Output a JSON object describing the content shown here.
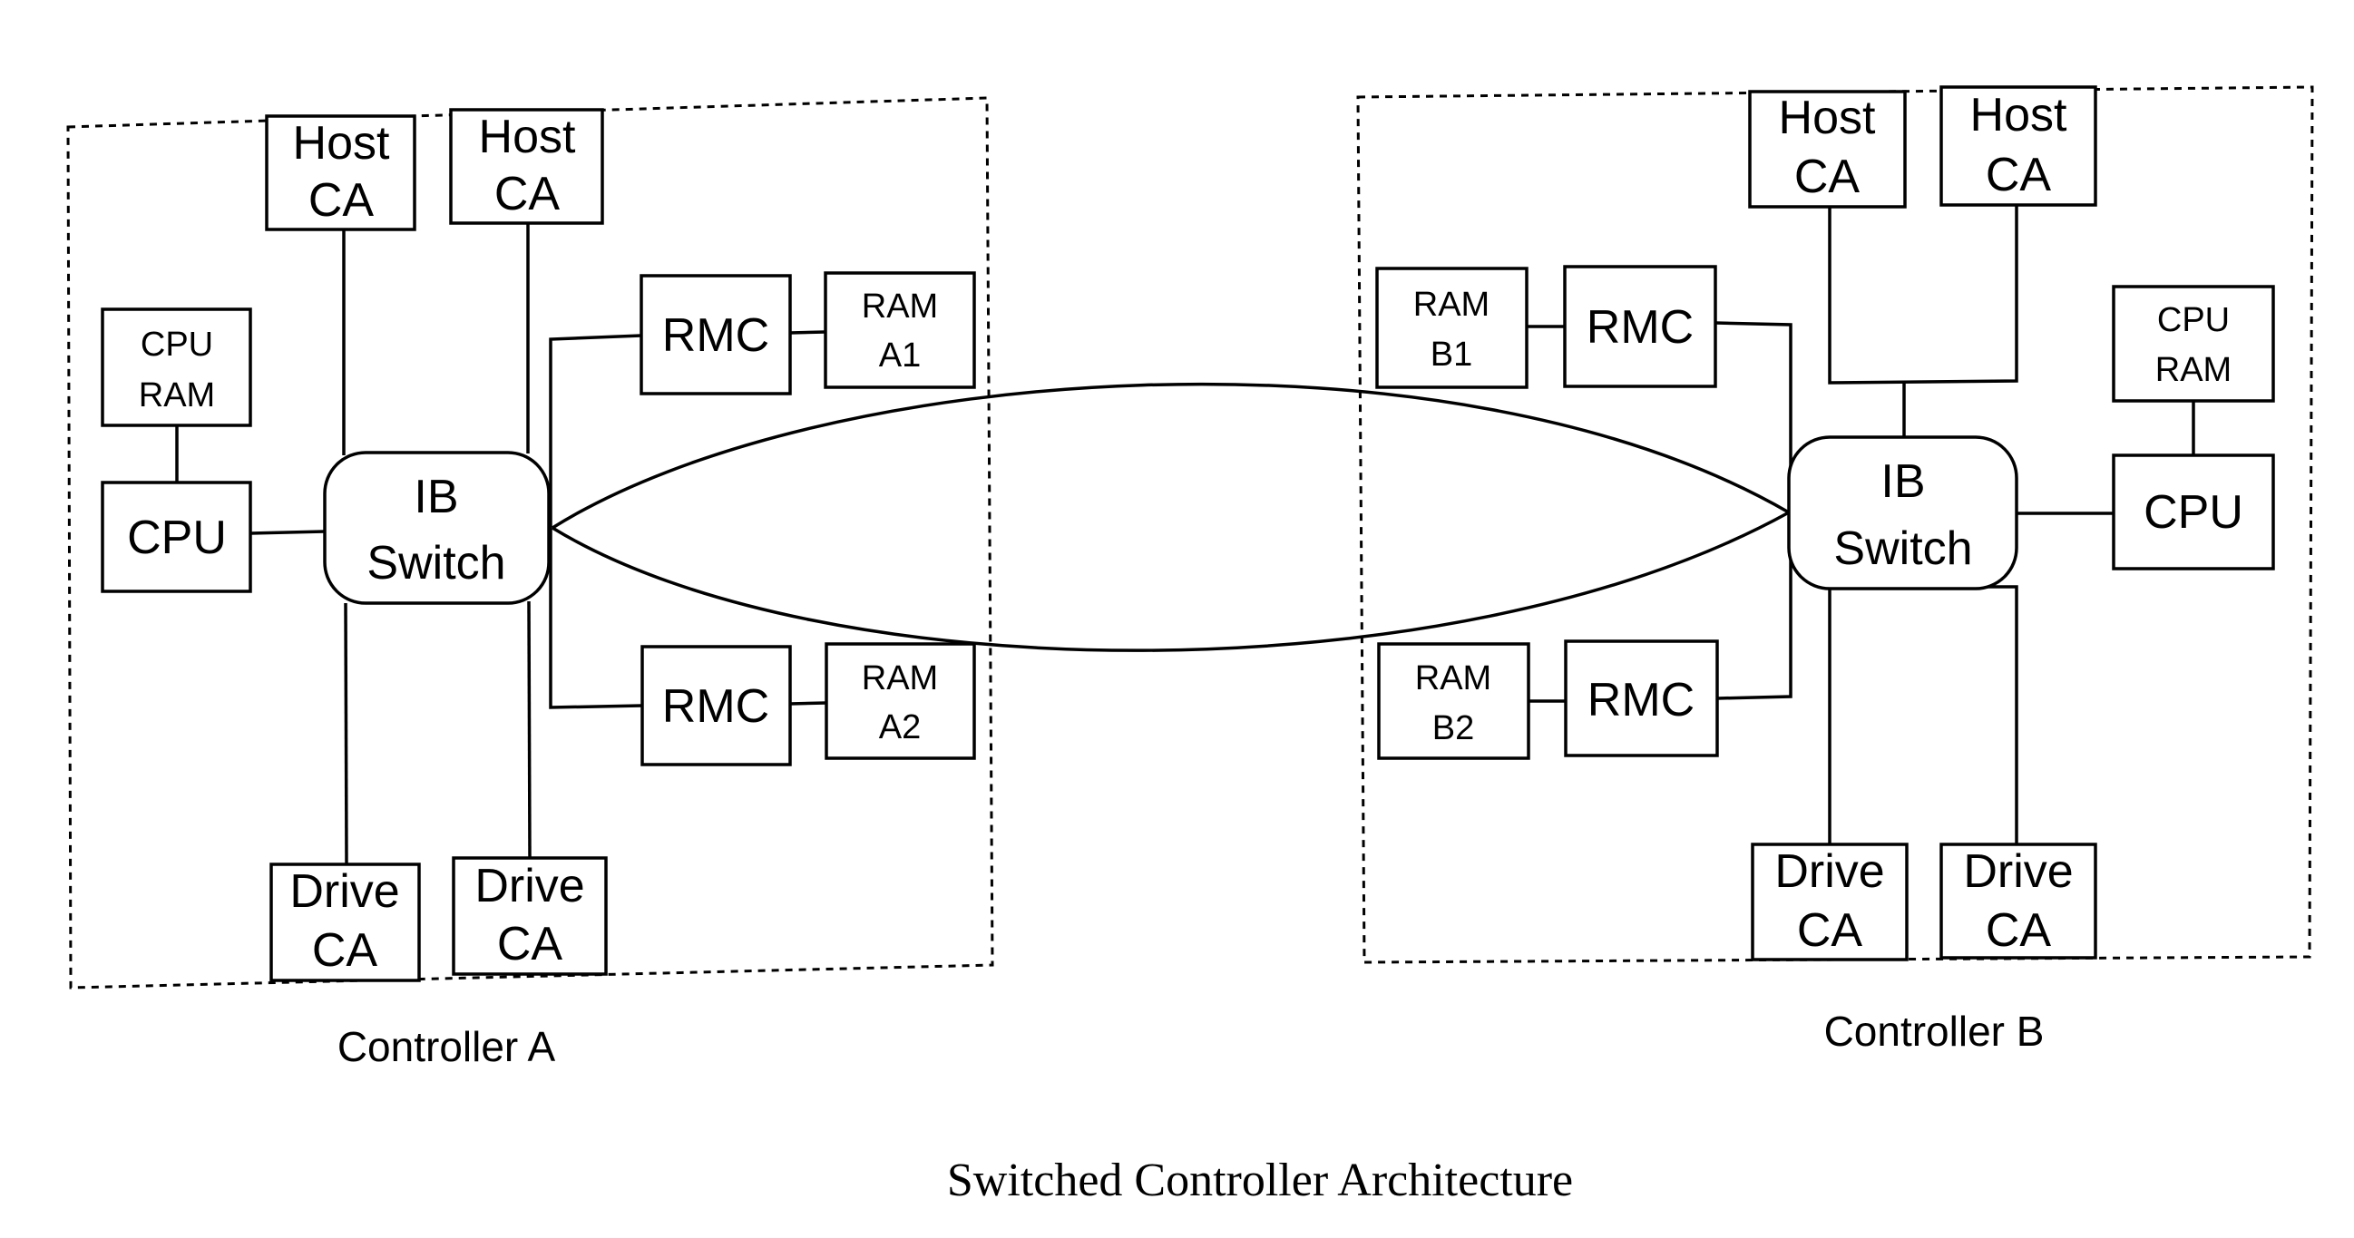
{
  "caption": "Switched Controller Architecture",
  "controller_a": {
    "label": "Controller A",
    "host_ca_1": [
      "Host",
      "CA"
    ],
    "host_ca_2": [
      "Host",
      "CA"
    ],
    "cpu_ram": [
      "CPU",
      "RAM"
    ],
    "cpu": "CPU",
    "switch": [
      "IB",
      "Switch"
    ],
    "rmc_1": "RMC",
    "ram_1": [
      "RAM",
      "A1"
    ],
    "rmc_2": "RMC",
    "ram_2": [
      "RAM",
      "A2"
    ],
    "drive_ca_1": [
      "Drive",
      "CA"
    ],
    "drive_ca_2": [
      "Drive",
      "CA"
    ]
  },
  "controller_b": {
    "label": "Controller B",
    "host_ca_1": [
      "Host",
      "CA"
    ],
    "host_ca_2": [
      "Host",
      "CA"
    ],
    "cpu_ram": [
      "CPU",
      "RAM"
    ],
    "cpu": "CPU",
    "switch": [
      "IB",
      "Switch"
    ],
    "rmc_1": "RMC",
    "ram_1": [
      "RAM",
      "B1"
    ],
    "rmc_2": "RMC",
    "ram_2": [
      "RAM",
      "B2"
    ],
    "drive_ca_1": [
      "Drive",
      "CA"
    ],
    "drive_ca_2": [
      "Drive",
      "CA"
    ]
  },
  "interconnect": {
    "links": 2,
    "from": "controller_a.switch",
    "to": "controller_b.switch"
  }
}
